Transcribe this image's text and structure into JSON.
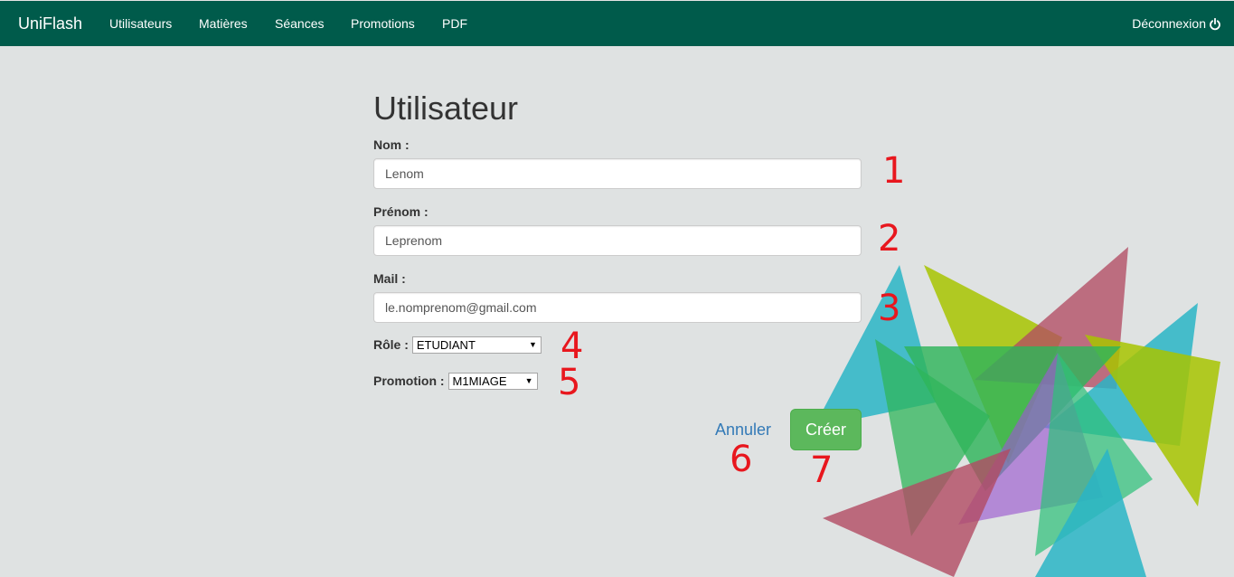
{
  "navbar": {
    "brand": "UniFlash",
    "links": [
      "Utilisateurs",
      "Matières",
      "Séances",
      "Promotions",
      "PDF"
    ],
    "logout_label": "Déconnexion",
    "background_color": "#005b4b"
  },
  "form": {
    "title": "Utilisateur",
    "nom_label": "Nom :",
    "nom_value": "Lenom",
    "prenom_label": "Prénom :",
    "prenom_value": "Leprenom",
    "mail_label": "Mail :",
    "mail_value": "le.nomprenom@gmail.com",
    "role_label": "Rôle :",
    "role_value": "ETUDIANT",
    "promotion_label": "Promotion :",
    "promotion_value": "M1MIAGE",
    "cancel_label": "Annuler",
    "create_label": "Créer"
  },
  "annotations": [
    "1",
    "2",
    "3",
    "4",
    "5",
    "6",
    "7"
  ],
  "colors": {
    "page_background": "#dfe2e2",
    "primary_button": "#5cb85c",
    "link": "#337ab7",
    "annotation": "#e8171e"
  },
  "icons": {
    "logout": "power-icon",
    "select_caret": "caret-down-icon"
  }
}
